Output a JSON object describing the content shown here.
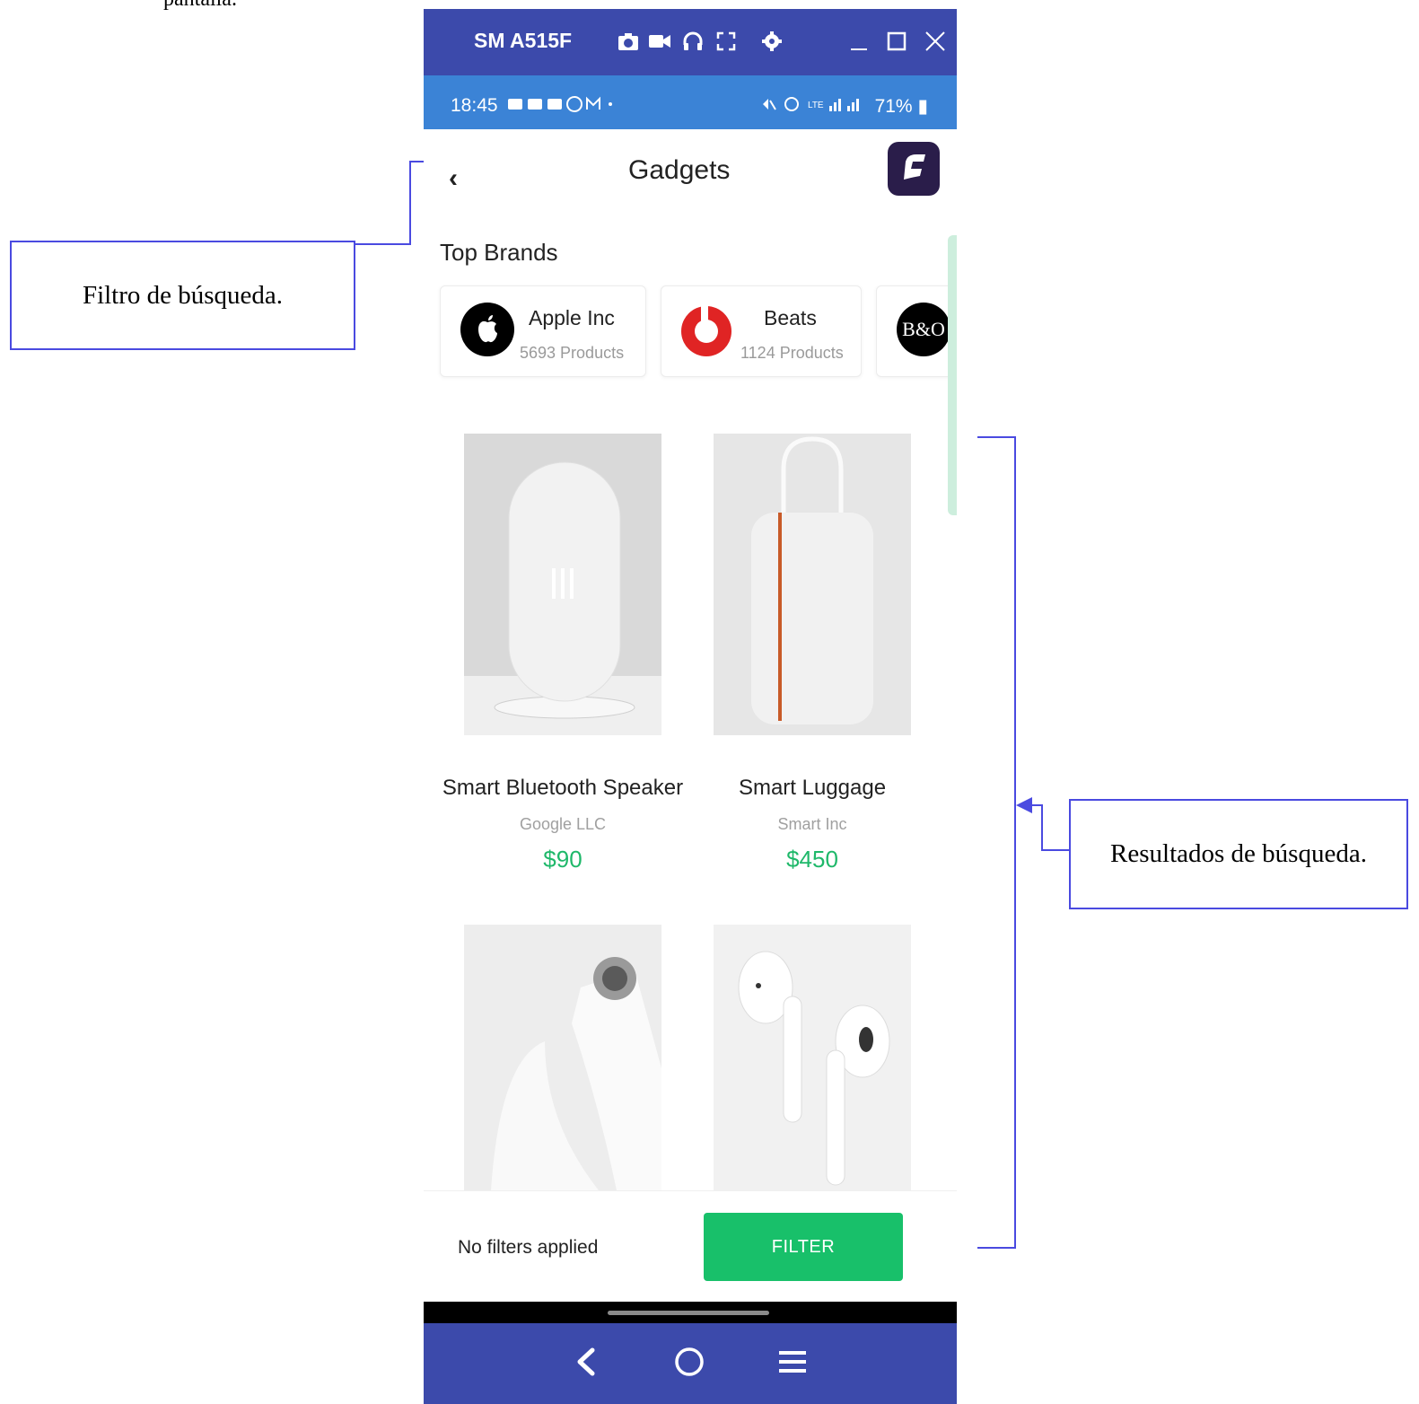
{
  "document": {
    "top_text": "pantalla.",
    "callout_filter": "Filtro de búsqueda.",
    "callout_results": "Resultados de búsqueda."
  },
  "window": {
    "device_name": "SM A515F",
    "toolbar_icons": [
      "camera-icon",
      "video-icon",
      "headphones-icon",
      "fullscreen-icon",
      "gear-icon"
    ],
    "controls": [
      "minimize",
      "maximize",
      "close"
    ]
  },
  "status_bar": {
    "time": "18:45",
    "battery": "71%"
  },
  "header": {
    "title": "Gadgets"
  },
  "brands": {
    "section_title": "Top Brands",
    "items": [
      {
        "name": "Apple Inc",
        "count": "5693 Products",
        "color": "#000000"
      },
      {
        "name": "Beats",
        "count": "1124 Products",
        "color": "#e02424"
      },
      {
        "name": "B&O",
        "count": "",
        "color": "#000000"
      }
    ]
  },
  "products": [
    {
      "name": "Smart Bluetooth Speaker",
      "brand": "Google LLC",
      "price": "$90"
    },
    {
      "name": "Smart Luggage",
      "brand": "Smart Inc",
      "price": "$450"
    },
    {
      "name": "",
      "brand": "",
      "price": ""
    },
    {
      "name": "",
      "brand": "",
      "price": ""
    }
  ],
  "filter_bar": {
    "status": "No filters applied",
    "button": "FILTER"
  },
  "colors": {
    "accent": "#18c06a",
    "titlebar": "#3c4aab",
    "statusbar": "#3b83d6",
    "annotation": "#4a4ae0"
  }
}
